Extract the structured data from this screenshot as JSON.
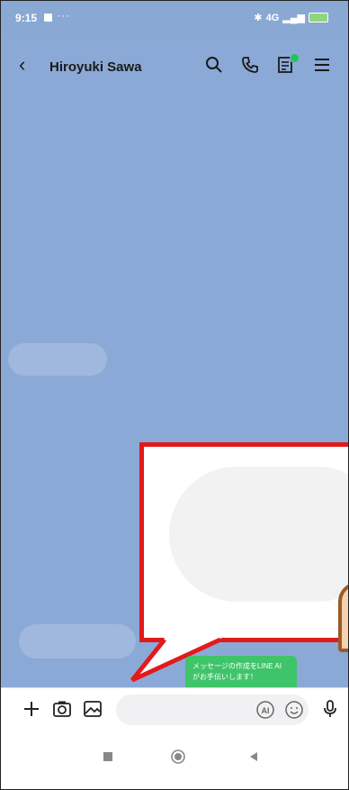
{
  "status_bar": {
    "time": "9:15",
    "dots": "···",
    "network": "4G",
    "icons": [
      "notification-box",
      "bluetooth-icon",
      "signal-icon",
      "battery-icon"
    ]
  },
  "header": {
    "title": "Hiroyuki Sawa",
    "icons": [
      "back-icon",
      "search-icon",
      "phone-icon",
      "notes-icon",
      "menu-icon"
    ],
    "badge_color": "#22c45a"
  },
  "tooltip": {
    "line1": "メッセージの作成をLINE AI",
    "line2": "がお手伝いします！",
    "color": "#3fc46a"
  },
  "input_bar": {
    "placeholder": "",
    "ai_label": "AI",
    "buttons": [
      "plus-icon",
      "camera-icon",
      "image-icon",
      "ai-icon",
      "emoji-icon",
      "mic-icon"
    ]
  },
  "nav_bar": {
    "buttons": [
      "recents-icon",
      "home-icon",
      "back-nav-icon"
    ]
  },
  "colors": {
    "chat_background": "#8ba9d6",
    "highlight_frame": "#e21a1a"
  }
}
